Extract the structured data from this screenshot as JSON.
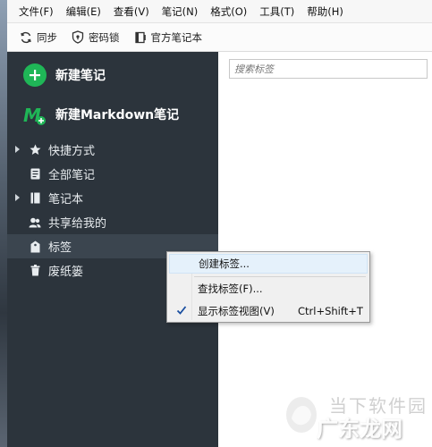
{
  "menubar": {
    "items": [
      "文件(F)",
      "编辑(E)",
      "查看(V)",
      "笔记(N)",
      "格式(O)",
      "工具(T)",
      "帮助(H)"
    ]
  },
  "toolbar": {
    "sync_label": "同步",
    "lock_label": "密码锁",
    "official_label": "官方笔记本",
    "icons": {
      "sync": "sync-icon",
      "lock": "shield-lock-icon",
      "official": "notebook-icon"
    }
  },
  "sidebar": {
    "new_note_label": "新建笔记",
    "new_markdown_label": "新建Markdown笔记",
    "items": [
      {
        "label": "快捷方式",
        "icon": "star-icon",
        "expandable": true
      },
      {
        "label": "全部笔记",
        "icon": "note-icon",
        "expandable": false
      },
      {
        "label": "笔记本",
        "icon": "notebook-icon",
        "expandable": true
      },
      {
        "label": "共享给我的",
        "icon": "people-icon",
        "expandable": false
      },
      {
        "label": "标签",
        "icon": "tag-icon",
        "expandable": false,
        "selected": true
      },
      {
        "label": "废纸篓",
        "icon": "trash-icon",
        "expandable": false
      }
    ],
    "colors": {
      "background": "#2c343c",
      "accent_green": "#1fb657"
    }
  },
  "search": {
    "placeholder": "搜索标签"
  },
  "context_menu": {
    "items": [
      {
        "label": "创建标签...",
        "shortcut": "",
        "checked": false,
        "highlighted": true
      },
      {
        "label": "查找标签(F)...",
        "shortcut": "",
        "checked": false
      },
      {
        "label": "显示标签视图(V)",
        "shortcut": "Ctrl+Shift+T",
        "checked": true
      }
    ]
  },
  "watermark": {
    "top_text": "当下软件园",
    "bottom_text": "广东龙网"
  }
}
